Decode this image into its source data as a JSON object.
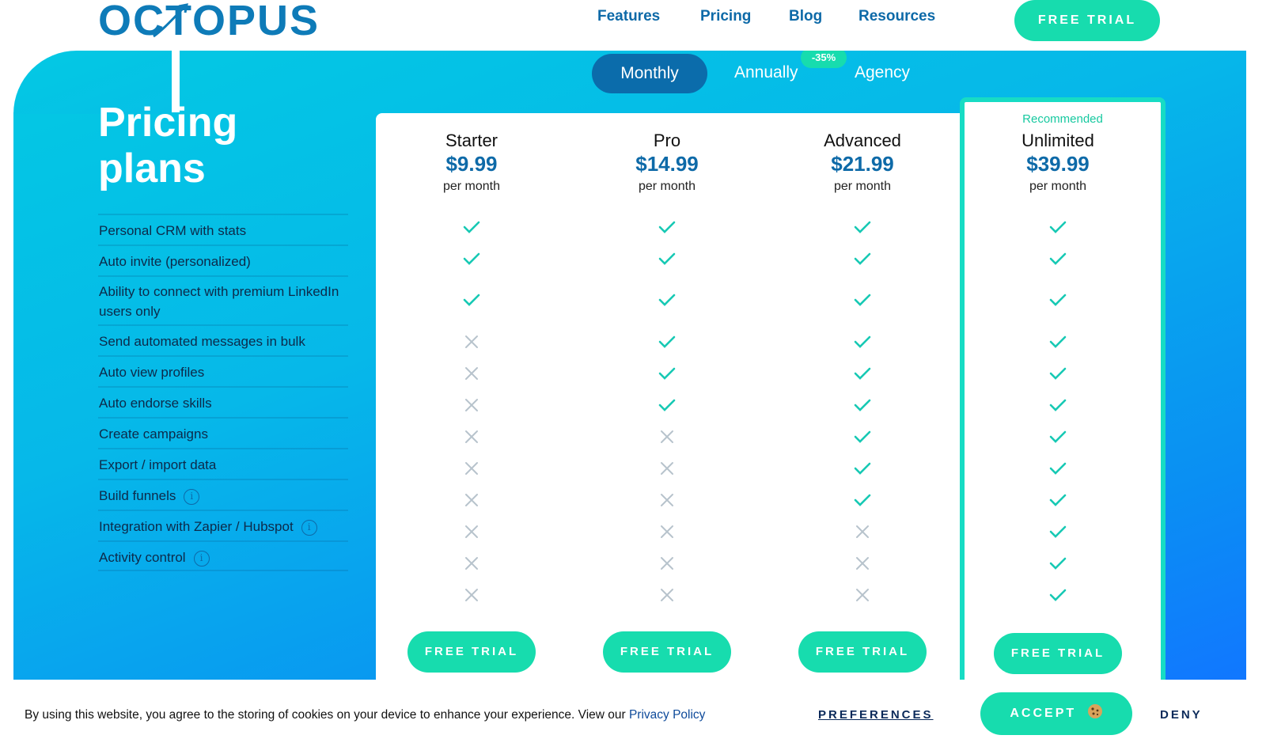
{
  "header": {
    "logo_text": "OCTOPUS",
    "nav": [
      "Features",
      "Pricing",
      "Blog",
      "Resources"
    ],
    "cta_label": "FREE TRIAL"
  },
  "billing_toggle": {
    "options": [
      "Monthly",
      "Annually",
      "Agency"
    ],
    "selected": "Monthly",
    "discount_badge": "-35%"
  },
  "title": "Pricing plans",
  "features": [
    {
      "label": "Personal CRM with stats",
      "info": false
    },
    {
      "label": "Auto invite (personalized)",
      "info": false
    },
    {
      "label": "Ability to connect with premium LinkedIn users only",
      "info": false
    },
    {
      "label": "Send automated messages in bulk",
      "info": false
    },
    {
      "label": "Auto view profiles",
      "info": false
    },
    {
      "label": "Auto endorse skills",
      "info": false
    },
    {
      "label": "Create campaigns",
      "info": false
    },
    {
      "label": "Export / import data",
      "info": false
    },
    {
      "label": "Build funnels",
      "info": true
    },
    {
      "label": "Integration with Zapier / Hubspot",
      "info": true
    },
    {
      "label": "Activity control",
      "info": true
    }
  ],
  "plans": [
    {
      "name": "Starter",
      "price": "$9.99",
      "period": "per month",
      "recommended": "",
      "cta": "FREE TRIAL",
      "features": [
        true,
        true,
        true,
        false,
        false,
        false,
        false,
        false,
        false,
        false,
        false,
        false
      ]
    },
    {
      "name": "Pro",
      "price": "$14.99",
      "period": "per month",
      "recommended": "",
      "cta": "FREE TRIAL",
      "features": [
        true,
        true,
        true,
        true,
        true,
        true,
        false,
        false,
        false,
        false,
        false,
        false
      ]
    },
    {
      "name": "Advanced",
      "price": "$21.99",
      "period": "per month",
      "recommended": "",
      "cta": "FREE TRIAL",
      "features": [
        true,
        true,
        true,
        true,
        true,
        true,
        true,
        true,
        true,
        false,
        false,
        false
      ]
    },
    {
      "name": "Unlimited",
      "price": "$39.99",
      "period": "per month",
      "recommended": "Recommended",
      "cta": "FREE TRIAL",
      "features": [
        true,
        true,
        true,
        true,
        true,
        true,
        true,
        true,
        true,
        true,
        true,
        true
      ]
    }
  ],
  "cookie_bar": {
    "text": "By using this website, you agree to the storing of cookies on your device to enhance your experience. View our ",
    "link": "Privacy Policy",
    "preferences": "PREFERENCES",
    "accept": "ACCEPT",
    "accept_icon": "cookie-icon",
    "deny": "DENY"
  },
  "colors": {
    "accent": "#17dcae",
    "brand": "#0e6aa8",
    "check": "#17c9b4",
    "cross": "#b7c3cc"
  }
}
